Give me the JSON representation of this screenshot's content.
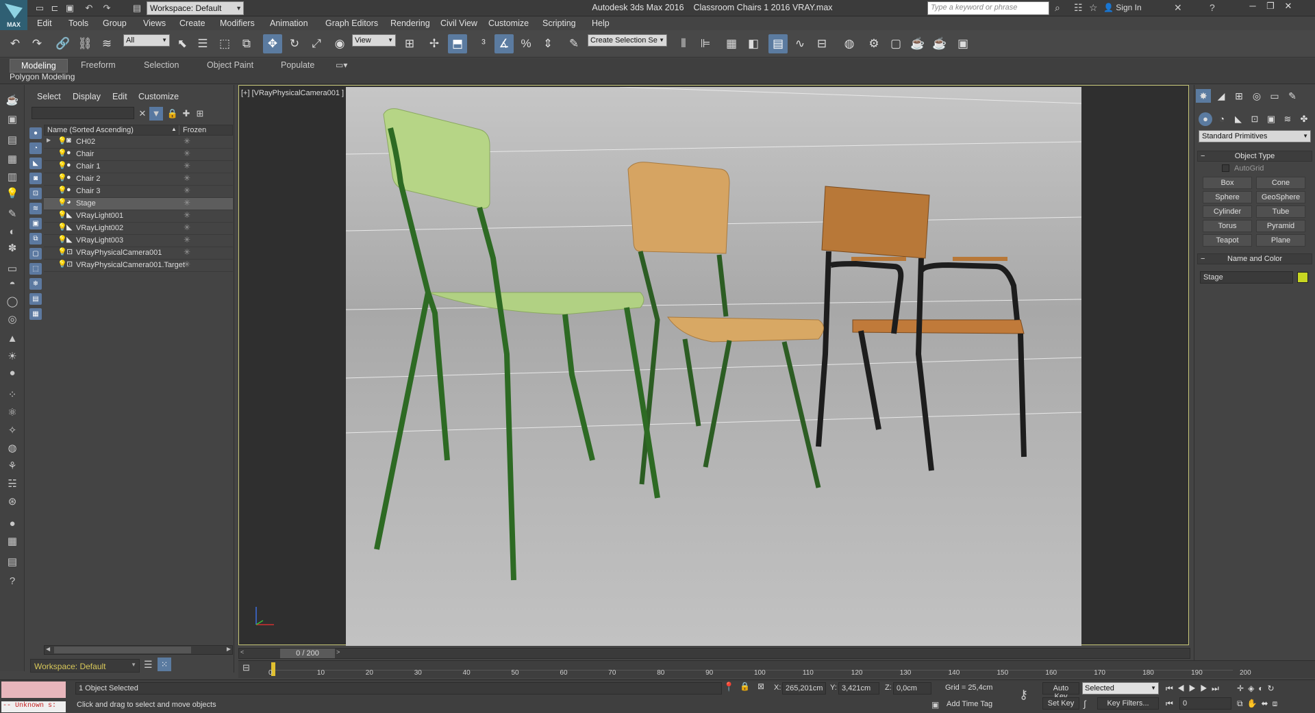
{
  "app": {
    "name": "Autodesk 3ds Max 2016",
    "file": "Classroom Chairs 1 2016 VRAY.max",
    "logo_label": "MAX"
  },
  "quick_access": {
    "workspace": "Workspace: Default"
  },
  "search": {
    "placeholder": "Type a keyword or phrase"
  },
  "account": {
    "sign_in": "Sign In"
  },
  "menus": [
    "Edit",
    "Tools",
    "Group",
    "Views",
    "Create",
    "Modifiers",
    "Animation",
    "Graph Editors",
    "Rendering",
    "Civil View",
    "Customize",
    "Scripting",
    "Help"
  ],
  "toolbar": {
    "selection_filter": "All",
    "ref_coord": "View",
    "named_selection": "Create Selection Se"
  },
  "ribbon": {
    "tabs": [
      "Modeling",
      "Freeform",
      "Selection",
      "Object Paint",
      "Populate"
    ],
    "active_tab": "Modeling",
    "panel": "Polygon Modeling"
  },
  "scene_explorer": {
    "menus": [
      "Select",
      "Display",
      "Edit",
      "Customize"
    ],
    "header": {
      "name_col": "Name (Sorted Ascending)",
      "frozen_col": "Frozen",
      "sort_arrow": "▲"
    },
    "rows": [
      {
        "name": "CH02",
        "expandable": true,
        "selected": false,
        "icon": "group-icon"
      },
      {
        "name": "Chair",
        "expandable": false,
        "selected": false,
        "icon": "geometry-icon"
      },
      {
        "name": "Chair 1",
        "expandable": false,
        "selected": false,
        "icon": "geometry-icon"
      },
      {
        "name": "Chair 2",
        "expandable": false,
        "selected": false,
        "icon": "geometry-icon"
      },
      {
        "name": "Chair 3",
        "expandable": false,
        "selected": false,
        "icon": "geometry-icon"
      },
      {
        "name": "Stage",
        "expandable": false,
        "selected": true,
        "icon": "geometry-icon"
      },
      {
        "name": "VRayLight001",
        "expandable": false,
        "selected": false,
        "icon": "light-icon"
      },
      {
        "name": "VRayLight002",
        "expandable": false,
        "selected": false,
        "icon": "light-icon"
      },
      {
        "name": "VRayLight003",
        "expandable": false,
        "selected": false,
        "icon": "light-icon"
      },
      {
        "name": "VRayPhysicalCamera001",
        "expandable": false,
        "selected": false,
        "icon": "camera-icon"
      },
      {
        "name": "VRayPhysicalCamera001.Target",
        "expandable": false,
        "selected": false,
        "icon": "camera-icon"
      }
    ],
    "workspace_label": "Workspace: Default"
  },
  "viewport": {
    "label": "[+] [VRayPhysicalCamera001 ]"
  },
  "command_panel": {
    "dropdown": "Standard Primitives",
    "object_type_title": "Object Type",
    "autogrid": "AutoGrid",
    "primitives": [
      "Box",
      "Cone",
      "Sphere",
      "GeoSphere",
      "Cylinder",
      "Tube",
      "Torus",
      "Pyramid",
      "Teapot",
      "Plane"
    ],
    "name_color_title": "Name and Color",
    "object_name": "Stage",
    "object_color": "#c8d622"
  },
  "timeline": {
    "slider_label": "0 / 200",
    "ticks": [
      "0",
      "10",
      "20",
      "30",
      "40",
      "50",
      "60",
      "70",
      "80",
      "90",
      "100",
      "110",
      "120",
      "130",
      "140",
      "150",
      "160",
      "170",
      "180",
      "190",
      "200"
    ]
  },
  "status": {
    "maxscript": "-- Unknown s:",
    "selection": "1 Object Selected",
    "prompt": "Click and drag to select and move objects",
    "x_label": "X:",
    "x": "265,201cm",
    "y_label": "Y:",
    "y": "3,421cm",
    "z_label": "Z:",
    "z": "0,0cm",
    "grid": "Grid = 25,4cm",
    "add_time_tag": "Add Time Tag",
    "auto_key": "Auto Key",
    "set_key": "Set Key",
    "key_mode": "Selected",
    "key_filters": "Key Filters...",
    "frame": "0"
  }
}
